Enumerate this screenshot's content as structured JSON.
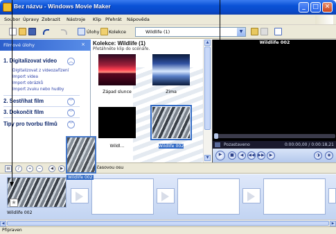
{
  "window": {
    "title": "Bez názvu - Windows Movie Maker",
    "minimize": "_",
    "maximize": "□",
    "close": "✕"
  },
  "menu": [
    "Soubor",
    "Úpravy",
    "Zobrazit",
    "Nástroje",
    "Klip",
    "Přehrát",
    "Nápověda"
  ],
  "toolbar": {
    "tasks_label": "Úlohy",
    "collections_label": "Kolekce",
    "collection_value": "Wildlife (1)"
  },
  "task_pane": {
    "header": "Filmové úlohy",
    "close": "×",
    "sections": [
      {
        "title": "1. Digitalizovat video",
        "expanded": true,
        "links": [
          "Digitalizovat z videozařízení",
          "Import videa",
          "Import obrázků",
          "Import zvuku nebo hudby"
        ]
      },
      {
        "title": "2. Sestříhat film",
        "expanded": false
      },
      {
        "title": "3. Dokončit film",
        "expanded": false
      },
      {
        "title": "Tipy pro tvorbu filmů",
        "expanded": false
      }
    ]
  },
  "collection": {
    "title": "Kolekce: Wildlife (1)",
    "subtitle": "Přetáhněte klip do scénáře.",
    "clips": [
      {
        "label": "Západ slunce",
        "art": "sunset"
      },
      {
        "label": "Zima",
        "art": "glacier"
      },
      {
        "label": "Wildl...",
        "art": "blackclip"
      },
      {
        "label": "Wildlife 002",
        "art": "penguins",
        "selected": true
      }
    ]
  },
  "preview": {
    "title": "Wildlife 002",
    "status": "Pozastaveno",
    "time": "0:00:00,00 / 0:00:18,21",
    "seek_fraction": 0.0
  },
  "storyboard": {
    "toolbar_label": "Zobrazit časovou osu",
    "drag_tooltip": "Wildlife 002",
    "first_clip_label": "Wildlife 002"
  },
  "status": "Připraven",
  "colors": {
    "titlebar": "#0a52d6",
    "selection": "#316ac5",
    "taskpane_text": "#0a246a"
  }
}
